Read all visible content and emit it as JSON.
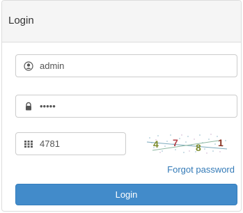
{
  "panel": {
    "title": "Login"
  },
  "form": {
    "username": {
      "value": "admin",
      "icon": "user-icon"
    },
    "password": {
      "value": "•••••",
      "icon": "lock-icon"
    },
    "captcha": {
      "value": "4781",
      "icon": "keypad-icon",
      "image_text": "4781"
    },
    "forgot_label": "Forgot password",
    "submit_label": "Login"
  },
  "colors": {
    "primary": "#428bca",
    "link": "#337ab7",
    "header_bg": "#f5f5f5",
    "border": "#dddddd"
  }
}
